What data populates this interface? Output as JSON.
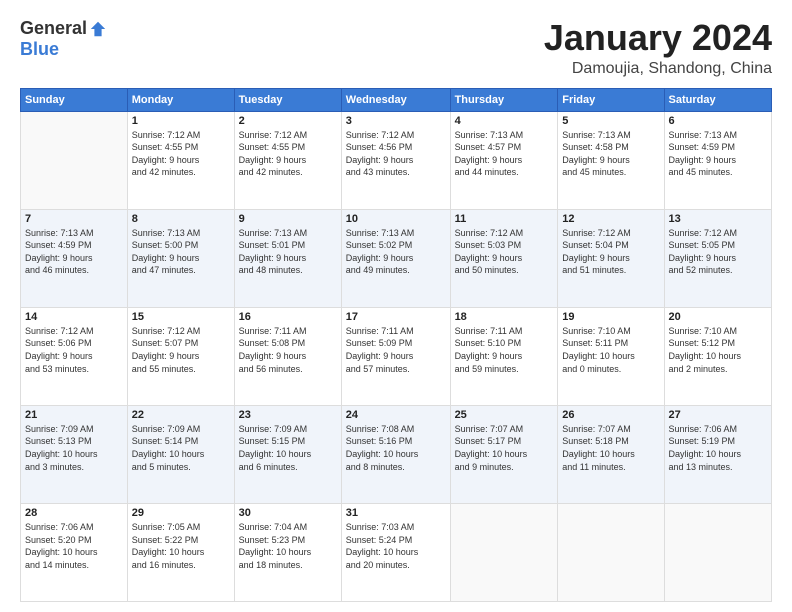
{
  "logo": {
    "general": "General",
    "blue": "Blue"
  },
  "title": "January 2024",
  "location": "Damoujia, Shandong, China",
  "days_of_week": [
    "Sunday",
    "Monday",
    "Tuesday",
    "Wednesday",
    "Thursday",
    "Friday",
    "Saturday"
  ],
  "weeks": [
    [
      {
        "day": "",
        "info": ""
      },
      {
        "day": "1",
        "info": "Sunrise: 7:12 AM\nSunset: 4:55 PM\nDaylight: 9 hours\nand 42 minutes."
      },
      {
        "day": "2",
        "info": "Sunrise: 7:12 AM\nSunset: 4:55 PM\nDaylight: 9 hours\nand 42 minutes."
      },
      {
        "day": "3",
        "info": "Sunrise: 7:12 AM\nSunset: 4:56 PM\nDaylight: 9 hours\nand 43 minutes."
      },
      {
        "day": "4",
        "info": "Sunrise: 7:13 AM\nSunset: 4:57 PM\nDaylight: 9 hours\nand 44 minutes."
      },
      {
        "day": "5",
        "info": "Sunrise: 7:13 AM\nSunset: 4:58 PM\nDaylight: 9 hours\nand 45 minutes."
      },
      {
        "day": "6",
        "info": "Sunrise: 7:13 AM\nSunset: 4:59 PM\nDaylight: 9 hours\nand 45 minutes."
      }
    ],
    [
      {
        "day": "7",
        "info": "Sunrise: 7:13 AM\nSunset: 4:59 PM\nDaylight: 9 hours\nand 46 minutes."
      },
      {
        "day": "8",
        "info": "Sunrise: 7:13 AM\nSunset: 5:00 PM\nDaylight: 9 hours\nand 47 minutes."
      },
      {
        "day": "9",
        "info": "Sunrise: 7:13 AM\nSunset: 5:01 PM\nDaylight: 9 hours\nand 48 minutes."
      },
      {
        "day": "10",
        "info": "Sunrise: 7:13 AM\nSunset: 5:02 PM\nDaylight: 9 hours\nand 49 minutes."
      },
      {
        "day": "11",
        "info": "Sunrise: 7:12 AM\nSunset: 5:03 PM\nDaylight: 9 hours\nand 50 minutes."
      },
      {
        "day": "12",
        "info": "Sunrise: 7:12 AM\nSunset: 5:04 PM\nDaylight: 9 hours\nand 51 minutes."
      },
      {
        "day": "13",
        "info": "Sunrise: 7:12 AM\nSunset: 5:05 PM\nDaylight: 9 hours\nand 52 minutes."
      }
    ],
    [
      {
        "day": "14",
        "info": "Sunrise: 7:12 AM\nSunset: 5:06 PM\nDaylight: 9 hours\nand 53 minutes."
      },
      {
        "day": "15",
        "info": "Sunrise: 7:12 AM\nSunset: 5:07 PM\nDaylight: 9 hours\nand 55 minutes."
      },
      {
        "day": "16",
        "info": "Sunrise: 7:11 AM\nSunset: 5:08 PM\nDaylight: 9 hours\nand 56 minutes."
      },
      {
        "day": "17",
        "info": "Sunrise: 7:11 AM\nSunset: 5:09 PM\nDaylight: 9 hours\nand 57 minutes."
      },
      {
        "day": "18",
        "info": "Sunrise: 7:11 AM\nSunset: 5:10 PM\nDaylight: 9 hours\nand 59 minutes."
      },
      {
        "day": "19",
        "info": "Sunrise: 7:10 AM\nSunset: 5:11 PM\nDaylight: 10 hours\nand 0 minutes."
      },
      {
        "day": "20",
        "info": "Sunrise: 7:10 AM\nSunset: 5:12 PM\nDaylight: 10 hours\nand 2 minutes."
      }
    ],
    [
      {
        "day": "21",
        "info": "Sunrise: 7:09 AM\nSunset: 5:13 PM\nDaylight: 10 hours\nand 3 minutes."
      },
      {
        "day": "22",
        "info": "Sunrise: 7:09 AM\nSunset: 5:14 PM\nDaylight: 10 hours\nand 5 minutes."
      },
      {
        "day": "23",
        "info": "Sunrise: 7:09 AM\nSunset: 5:15 PM\nDaylight: 10 hours\nand 6 minutes."
      },
      {
        "day": "24",
        "info": "Sunrise: 7:08 AM\nSunset: 5:16 PM\nDaylight: 10 hours\nand 8 minutes."
      },
      {
        "day": "25",
        "info": "Sunrise: 7:07 AM\nSunset: 5:17 PM\nDaylight: 10 hours\nand 9 minutes."
      },
      {
        "day": "26",
        "info": "Sunrise: 7:07 AM\nSunset: 5:18 PM\nDaylight: 10 hours\nand 11 minutes."
      },
      {
        "day": "27",
        "info": "Sunrise: 7:06 AM\nSunset: 5:19 PM\nDaylight: 10 hours\nand 13 minutes."
      }
    ],
    [
      {
        "day": "28",
        "info": "Sunrise: 7:06 AM\nSunset: 5:20 PM\nDaylight: 10 hours\nand 14 minutes."
      },
      {
        "day": "29",
        "info": "Sunrise: 7:05 AM\nSunset: 5:22 PM\nDaylight: 10 hours\nand 16 minutes."
      },
      {
        "day": "30",
        "info": "Sunrise: 7:04 AM\nSunset: 5:23 PM\nDaylight: 10 hours\nand 18 minutes."
      },
      {
        "day": "31",
        "info": "Sunrise: 7:03 AM\nSunset: 5:24 PM\nDaylight: 10 hours\nand 20 minutes."
      },
      {
        "day": "",
        "info": ""
      },
      {
        "day": "",
        "info": ""
      },
      {
        "day": "",
        "info": ""
      }
    ]
  ]
}
